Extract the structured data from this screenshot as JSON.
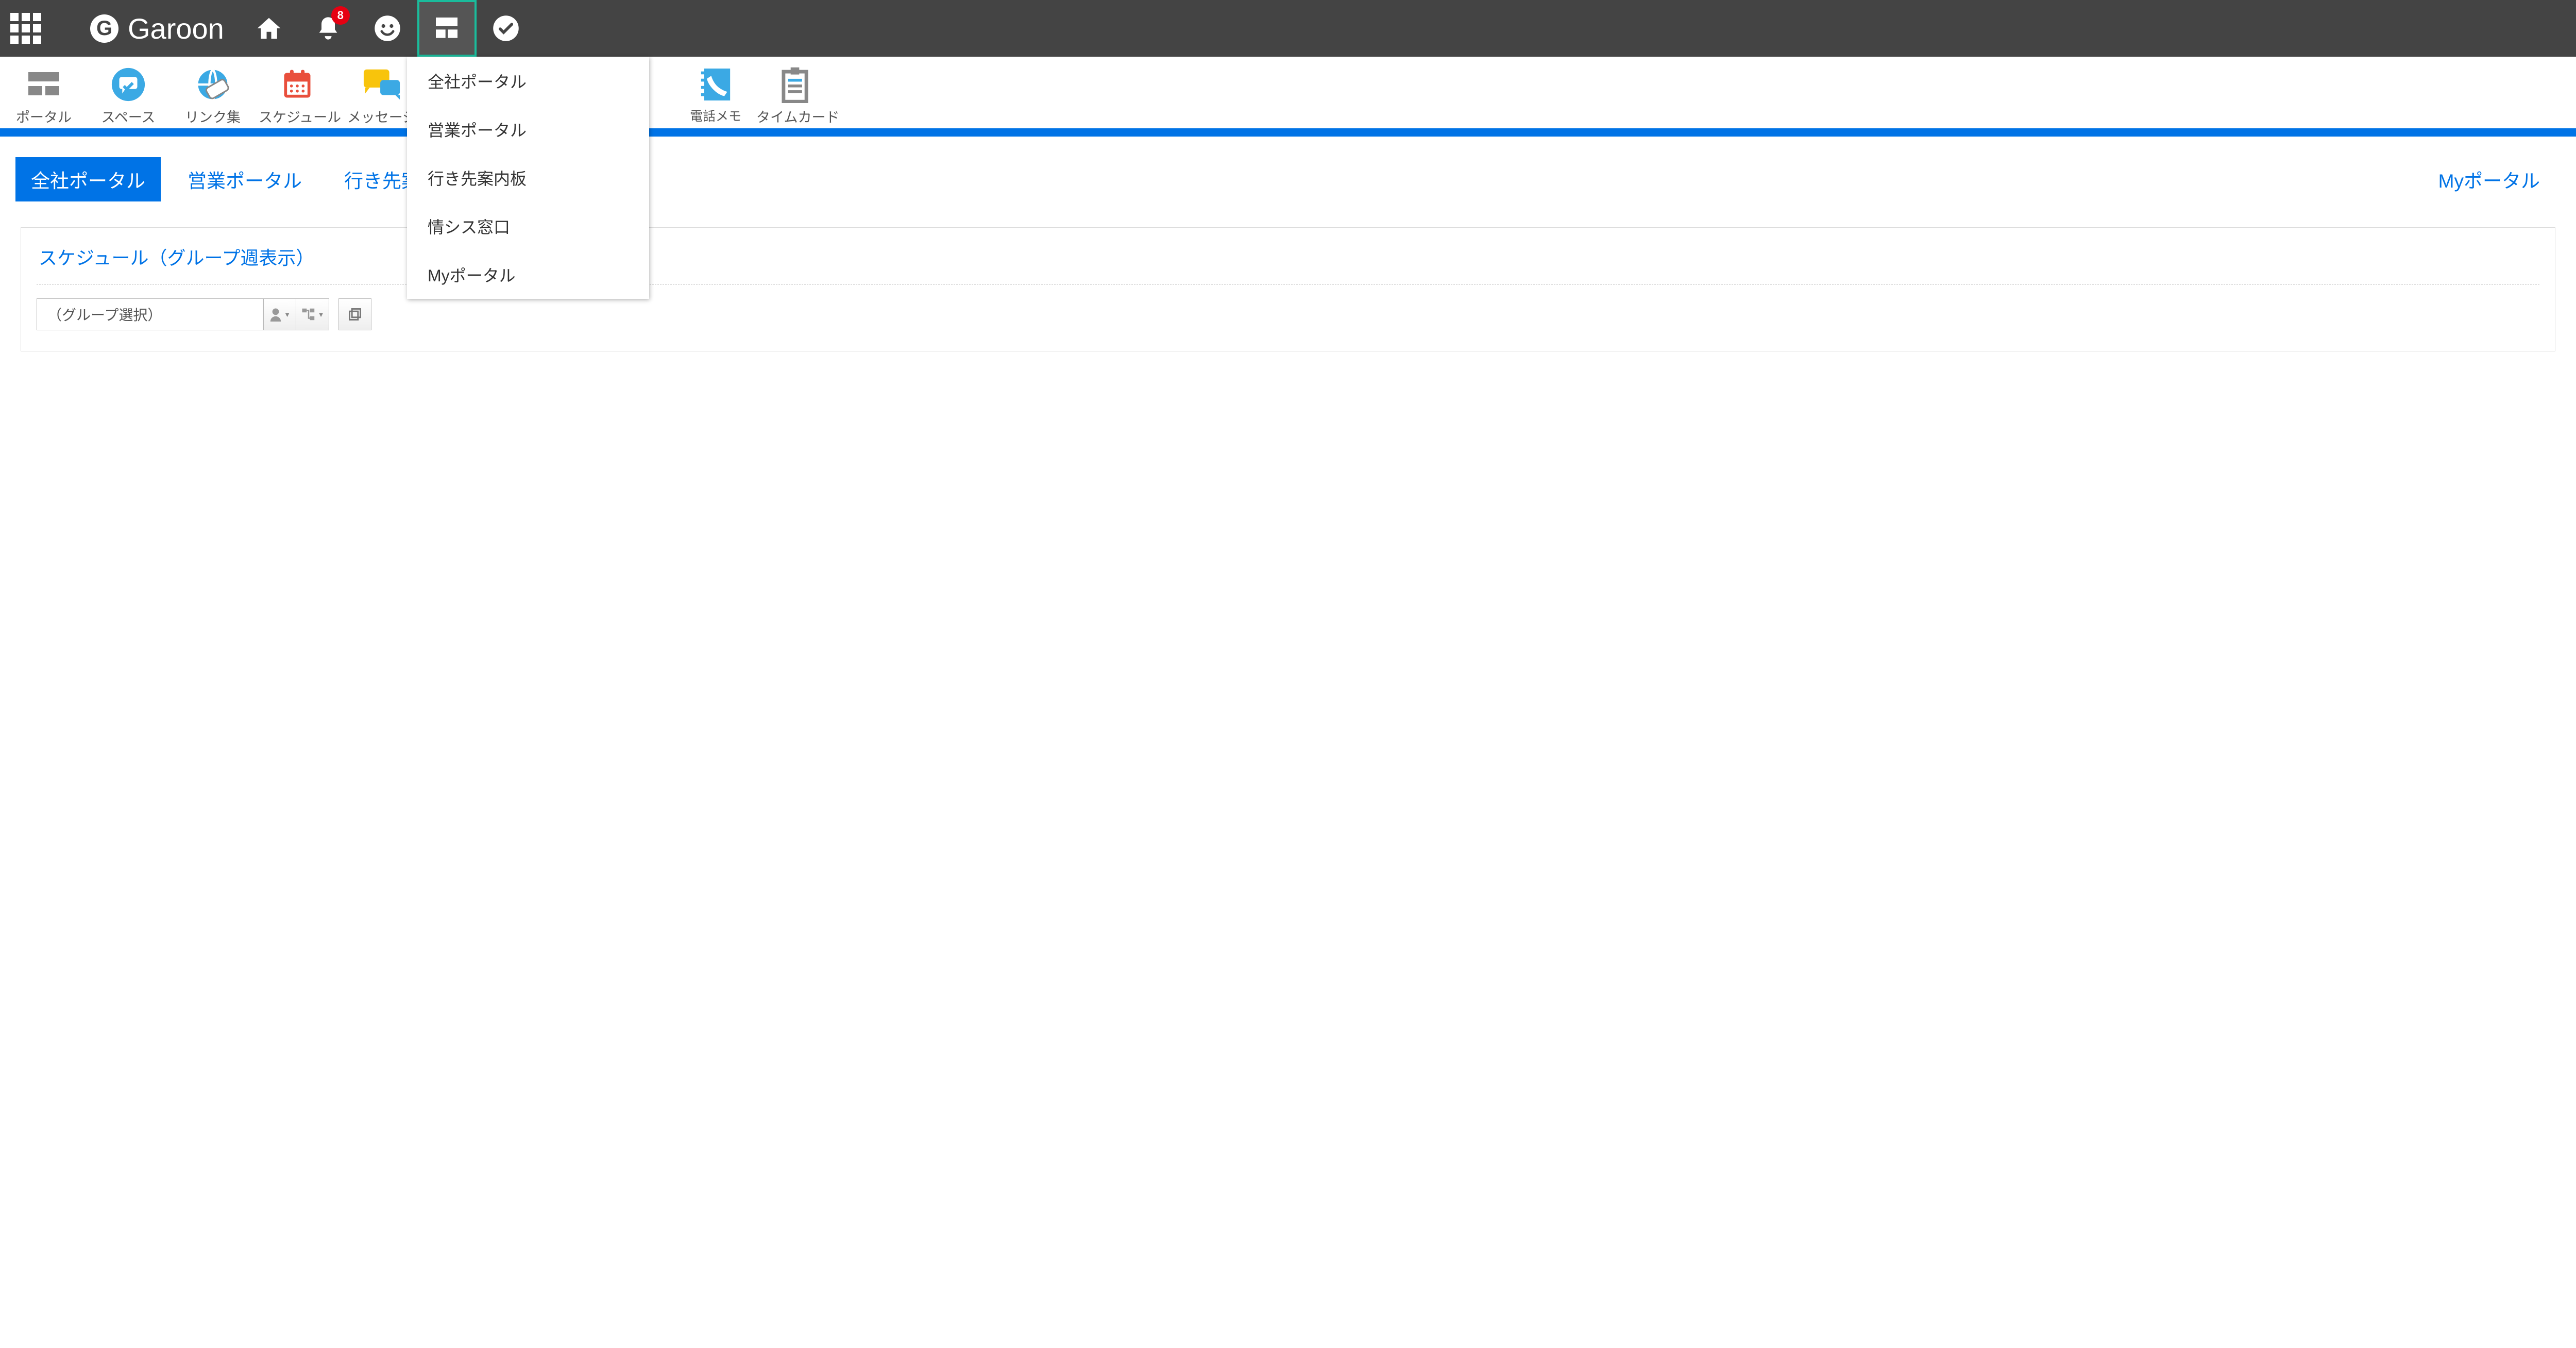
{
  "topbar": {
    "brand": "Garoon",
    "notification_count": "8"
  },
  "portal_menu": [
    "全社ポータル",
    "営業ポータル",
    "行き先案内板",
    "情シス窓口",
    "Myポータル"
  ],
  "apps": [
    {
      "label": "ポータル"
    },
    {
      "label": "スペース"
    },
    {
      "label": "リンク集"
    },
    {
      "label": "スケジュール"
    },
    {
      "label": "メッセージ"
    },
    {
      "label": "電話メモ"
    },
    {
      "label": "タイムカード"
    }
  ],
  "tabs": {
    "items": [
      {
        "label": "全社ポータル",
        "active": true
      },
      {
        "label": "営業ポータル"
      },
      {
        "label": "行き先案"
      }
    ],
    "right": "Myポータル"
  },
  "schedule": {
    "title": "スケジュール（グループ週表示）",
    "group_select": "（グループ選択）"
  }
}
